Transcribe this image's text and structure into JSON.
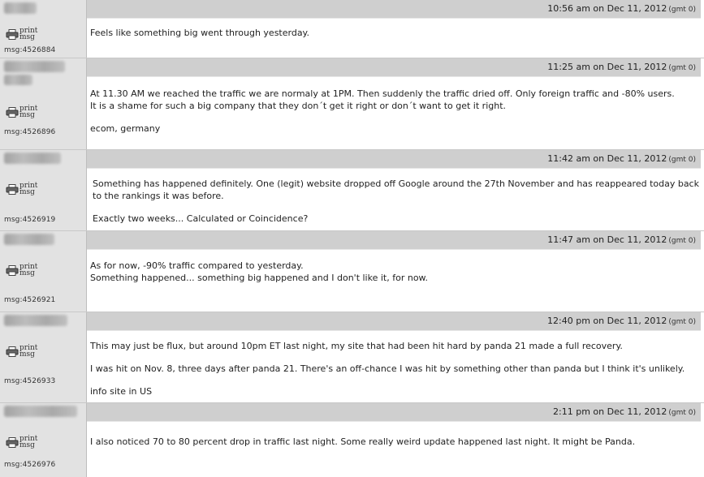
{
  "timezone_label": "(gmt 0)",
  "print_label": "print msg",
  "posts": [
    {
      "time": "10:56 am on Dec 11, 2012",
      "msg_id": "msg:4526884",
      "lines": [
        "Feels like something big went through yesterday."
      ]
    },
    {
      "time": "11:25 am on Dec 11, 2012",
      "msg_id": "msg:4526896",
      "lines": [
        "At 11.30 AM we reached the traffic we are normaly at 1PM. Then suddenly the traffic dried off. Only foreign traffic and -80% users.",
        "It is a shame for such a big company that they don´t get it right or don´t want to get it right.",
        "ecom, germany"
      ]
    },
    {
      "time": "11:42 am on Dec 11, 2012",
      "msg_id": "msg:4526919",
      "lines": [
        "Something has happened definitely. One (legit) website dropped off Google around the 27th November and has reappeared today back",
        "to the rankings it was before.",
        "Exactly two weeks... Calculated or Coincidence?"
      ]
    },
    {
      "time": "11:47 am on Dec 11, 2012",
      "msg_id": "msg:4526921",
      "lines": [
        "As for now, -90% traffic compared to yesterday.",
        "Something happened... something big happened and I don't like it, for now."
      ]
    },
    {
      "time": "12:40 pm on Dec 11, 2012",
      "msg_id": "msg:4526933",
      "lines": [
        "This may just be flux, but around 10pm ET last night, my site that had been hit hard by panda 21 made a full recovery.",
        "I was hit on Nov. 8, three days after panda 21. There's an off-chance I was hit by something other than panda but I think it's unlikely.",
        "info site in US"
      ]
    },
    {
      "time": "2:11 pm on Dec 11, 2012",
      "msg_id": "msg:4526976",
      "lines": [
        "I also noticed 70 to 80 percent drop in traffic last night. Some really weird update happened last night. It might be Panda."
      ]
    }
  ]
}
